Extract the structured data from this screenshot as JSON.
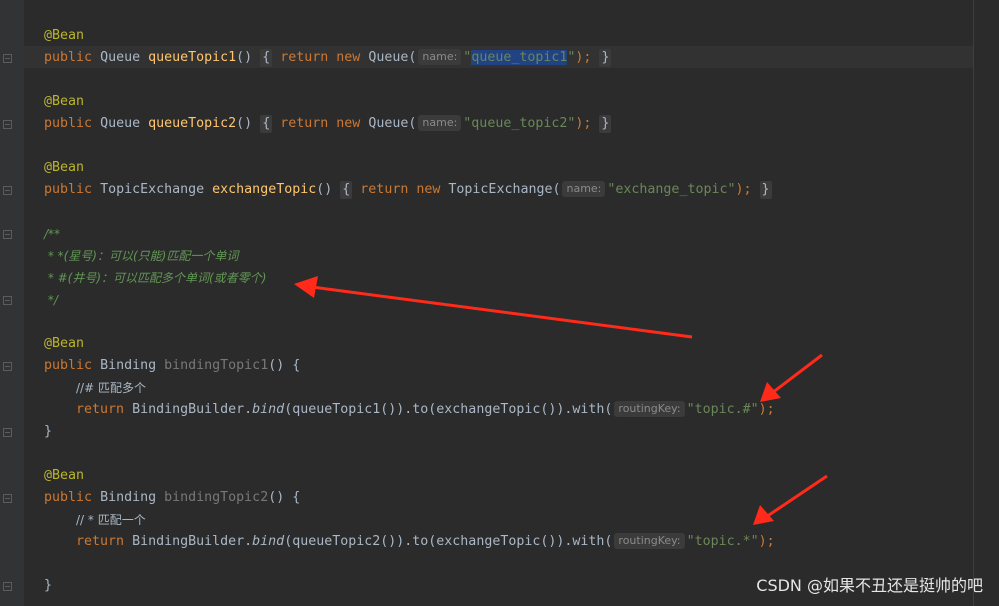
{
  "annotation": "@Bean",
  "q1": {
    "public": "public",
    "type": "Queue",
    "method": "queueTopic1",
    "parens": "()",
    "open": "{",
    "ret": "return",
    "new": "new",
    "ctor": "Queue(",
    "hint": "name:",
    "q1": "\"",
    "value": "queue_topic1",
    "q2": "\"",
    "close": ");",
    "brace": "}"
  },
  "q2": {
    "public": "public",
    "type": "Queue",
    "method": "queueTopic2",
    "parens": "()",
    "open": "{",
    "ret": "return",
    "new": "new",
    "ctor": "Queue(",
    "hint": "name:",
    "value": "\"queue_topic2\"",
    "close": ");",
    "brace": "}"
  },
  "ex": {
    "public": "public",
    "type": "TopicExchange",
    "method": "exchangeTopic",
    "parens": "()",
    "open": "{",
    "ret": "return",
    "new": "new",
    "ctor": "TopicExchange(",
    "hint": "name:",
    "value": "\"exchange_topic\"",
    "close": ");",
    "brace": "}"
  },
  "doc": {
    "l1": "/**",
    "l2": " * *(星号)：可以(只能)匹配一个单词",
    "l3": " * #(井号)：可以匹配多个单词(或者零个)",
    "l4": " */"
  },
  "b1": {
    "public": "public",
    "type": "Binding",
    "method": "bindingTopic1",
    "sig": "() {",
    "comment": "//# 匹配多个",
    "ret": "return",
    "body1": "BindingBuilder.",
    "bind": "bind",
    "body2": "(queueTopic1()).to(exchangeTopic()).with(",
    "hint": "routingKey:",
    "value": "\"topic.#\"",
    "close": ");",
    "end": "}"
  },
  "b2": {
    "public": "public",
    "type": "Binding",
    "method": "bindingTopic2",
    "sig": "() {",
    "comment": "// * 匹配一个",
    "ret": "return",
    "body1": "BindingBuilder.",
    "bind": "bind",
    "body2": "(queueTopic2()).to(exchangeTopic()).with(",
    "hint": "routingKey:",
    "value": "\"topic.*\"",
    "close": ");",
    "end": "}"
  },
  "watermark": "CSDN @如果不丑还是挺帅的吧",
  "colors": {
    "background": "#2b2b2b",
    "keyword": "#cc7832",
    "annotation": "#bbb529",
    "method": "#ffc66d",
    "string": "#6a8759",
    "doc_comment": "#629755",
    "selection": "#214283",
    "arrow": "#ff2a1a"
  }
}
